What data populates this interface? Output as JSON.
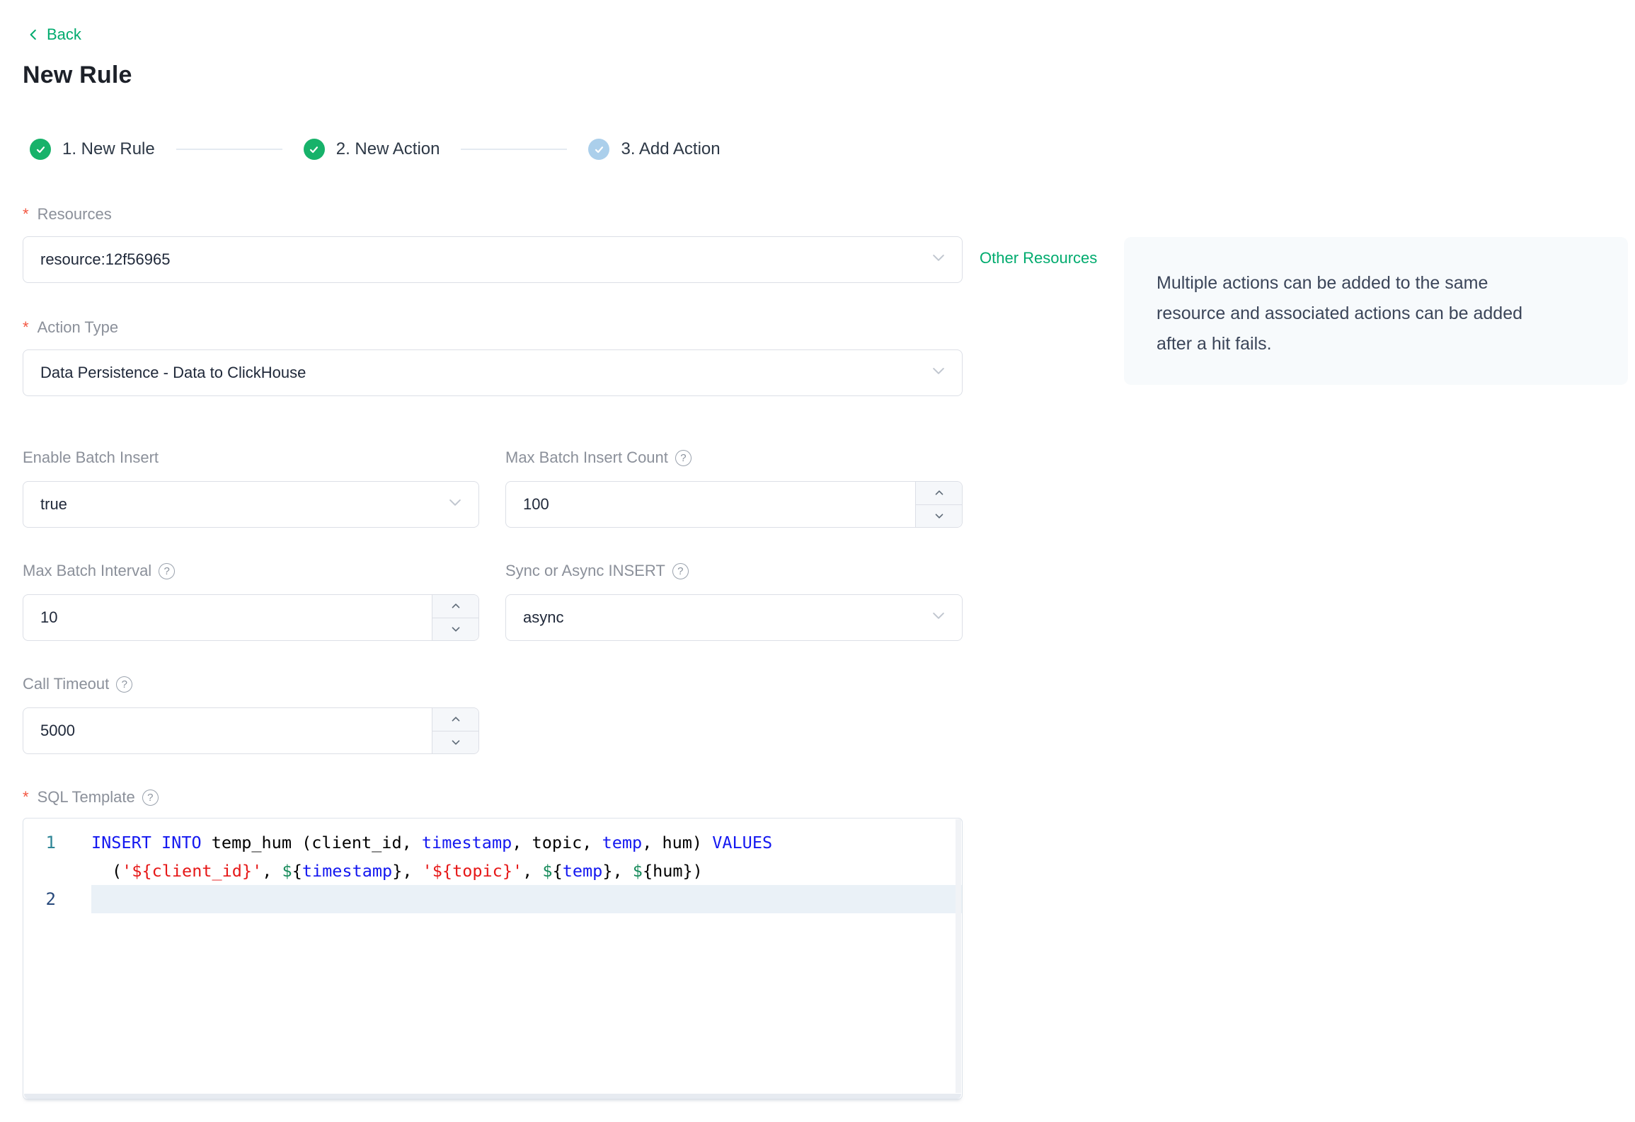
{
  "colors": {
    "brand_green": "#00ab6e",
    "step_done_green": "#17b26a",
    "step_pending_blue": "#abcfeb",
    "required_red": "#f35742",
    "label_gray": "#8b909a",
    "border_gray": "#dcdfe6",
    "info_box_bg": "#f7fafc",
    "code_keyword": "#1418f0",
    "code_string": "#e61717",
    "code_dollar": "#168a5a",
    "gutter_default": "#2e8596",
    "gutter_active": "#27497b",
    "active_line_bg": "#eaf1f7"
  },
  "misc": {
    "required_marker": "*",
    "help_glyph": "?"
  },
  "header": {
    "back_label": "Back",
    "title": "New Rule"
  },
  "steps": [
    {
      "label": "1. New Rule",
      "state": "done"
    },
    {
      "label": "2. New Action",
      "state": "done"
    },
    {
      "label": "3. Add Action",
      "state": "pending"
    }
  ],
  "form": {
    "resources": {
      "label": "Resources",
      "value": "resource:12f56965"
    },
    "other_resources_label": "Other Resources",
    "info_lines": [
      "Multiple actions can be added to the same",
      "resource and associated actions can be added",
      "after a hit fails."
    ],
    "action_type": {
      "label": "Action Type",
      "value": "Data Persistence - Data to ClickHouse"
    },
    "enable_batch": {
      "label": "Enable Batch Insert",
      "value": "true"
    },
    "max_batch_count": {
      "label": "Max Batch Insert Count",
      "value": "100"
    },
    "max_batch_interval": {
      "label": "Max Batch Interval",
      "value": "10"
    },
    "sync_async": {
      "label": "Sync or Async INSERT",
      "value": "async"
    },
    "call_timeout": {
      "label": "Call Timeout",
      "value": "5000"
    },
    "sql_template_label": "SQL Template"
  },
  "editor": {
    "lines": [
      {
        "number": "1",
        "active": false,
        "segments": [
          [
            {
              "t": "INSERT INTO",
              "c": "kw"
            },
            {
              "t": " temp_hum (client_id, ",
              "c": "def"
            },
            {
              "t": "timestamp",
              "c": "kw"
            },
            {
              "t": ", topic, ",
              "c": "def"
            },
            {
              "t": "temp",
              "c": "kw"
            },
            {
              "t": ", hum) ",
              "c": "def"
            },
            {
              "t": "VALUES",
              "c": "kw"
            }
          ],
          [
            {
              "t": "(",
              "c": "def"
            },
            {
              "t": "'${client_id}'",
              "c": "str"
            },
            {
              "t": ", ",
              "c": "def"
            },
            {
              "t": "$",
              "c": "var"
            },
            {
              "t": "{",
              "c": "def"
            },
            {
              "t": "timestamp",
              "c": "kw"
            },
            {
              "t": "}",
              "c": "def"
            },
            {
              "t": ", ",
              "c": "def"
            },
            {
              "t": "'${topic}'",
              "c": "str"
            },
            {
              "t": ", ",
              "c": "def"
            },
            {
              "t": "$",
              "c": "var"
            },
            {
              "t": "{",
              "c": "def"
            },
            {
              "t": "temp",
              "c": "kw"
            },
            {
              "t": "}",
              "c": "def"
            },
            {
              "t": ", ",
              "c": "def"
            },
            {
              "t": "$",
              "c": "var"
            },
            {
              "t": "{hum})",
              "c": "def"
            }
          ]
        ]
      },
      {
        "number": "2",
        "active": true,
        "segments": [
          []
        ]
      }
    ]
  }
}
